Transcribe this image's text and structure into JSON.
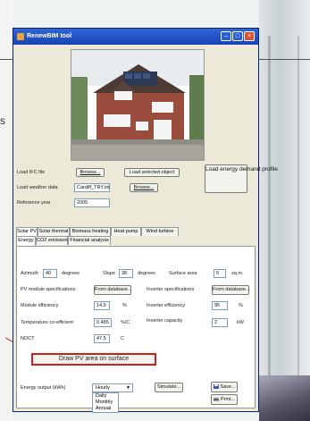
{
  "background": {
    "edge_text": "s"
  },
  "window": {
    "title": "RenewBIM tool",
    "controls": {
      "minimize": "–",
      "maximize": "□",
      "close": "×"
    }
  },
  "load_section": {
    "ifc_label": "Load IFC file",
    "ifc_browse": "Browse...",
    "load_selected": "Load selected object",
    "weather_label": "Load weather data",
    "weather_value": "Cardiff_TRY.txt",
    "weather_browse": "Browse...",
    "year_label": "Reference year",
    "year_value": "2005",
    "load_profile_btn": "Load energy demand profile"
  },
  "tabs_top": [
    "Solar PV",
    "Solar thermal",
    "Biomass heating",
    "Heat pump",
    "Wind turbine"
  ],
  "tabs_sub": [
    "Energy",
    "CO2 emissions",
    "Financial analysis"
  ],
  "pv": {
    "azimuth_label": "Azimuth",
    "azimuth_value": "40",
    "azimuth_unit": "degrees",
    "slope_label": "Slope",
    "slope_value": "38",
    "slope_unit": "degrees",
    "surface_label": "Surface area",
    "surface_value": "5",
    "surface_unit": "sq.m.",
    "module_spec_label": "PV module specifications",
    "module_spec_btn": "From database...",
    "inverter_spec_label": "Inverter specifications",
    "inverter_spec_btn": "From database...",
    "module_eff_label": "Module efficiency",
    "module_eff_value": "14.9",
    "module_eff_unit": "%",
    "inverter_eff_label": "Inverter efficiency",
    "inverter_eff_value": "95",
    "inverter_eff_unit": "%",
    "temp_coef_label": "Temperature co-efficient",
    "temp_coef_value": "0.485",
    "temp_coef_unit": "%/C",
    "inverter_cap_label": "Inverter capacity",
    "inverter_cap_value": "2",
    "inverter_cap_unit": "kW",
    "noct_label": "NOCT",
    "noct_value": "47.5",
    "noct_unit": "C",
    "draw_btn": "Draw PV area on surface",
    "output_label": "Energy output (kWh)",
    "output_selected": "Hourly",
    "output_options": [
      "Daily",
      "Monthly",
      "Annual"
    ],
    "simulate_btn": "Simulate...",
    "save_btn": "Save...",
    "print_btn": "Print..."
  },
  "colors": {
    "titlebar": "#2f66d8",
    "highlight": "#cc2020",
    "window_bg": "#ece9d8"
  }
}
